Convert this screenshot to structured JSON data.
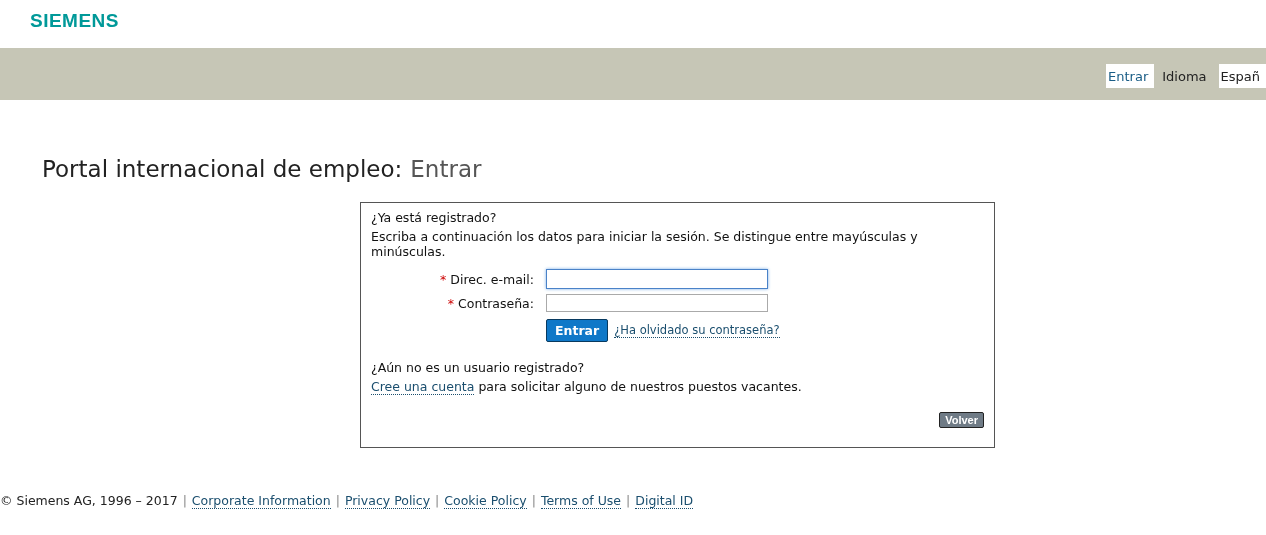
{
  "logo": "SIEMENS",
  "nav": [
    {
      "kind": "link",
      "label": "Entrar"
    },
    {
      "kind": "label",
      "label": "Idioma"
    },
    {
      "kind": "select",
      "label": "Españ"
    }
  ],
  "title": {
    "prefix": "Portal internacional de empleo:",
    "page": "Entrar"
  },
  "login": {
    "heading": "¿Ya está registrado?",
    "intro": "Escriba a continuación los datos para iniciar la sesión. Se distingue entre mayúsculas y minúsculas.",
    "fields": [
      {
        "required_mark": "*",
        "label": "Direc. e-mail:",
        "focused": true
      },
      {
        "required_mark": "*",
        "label": "Contraseña:",
        "focused": false
      }
    ],
    "submit": "Entrar",
    "forgot_link": "¿Ha olvidado su contraseña?"
  },
  "register": {
    "heading": "¿Aún no es un usuario registrado?",
    "link": "Cree una cuenta",
    "text": "para solicitar alguno de nuestros puestos vacantes."
  },
  "back_button": "Volver",
  "footer": {
    "copyright": "© Siemens AG, 1996 – 2017",
    "links": [
      {
        "separator": "|",
        "label": "Corporate Information"
      },
      {
        "separator": "|",
        "label": "Privacy Policy"
      },
      {
        "separator": "|",
        "label": "Cookie Policy"
      },
      {
        "separator": "|",
        "label": "Terms of Use"
      },
      {
        "separator": "|",
        "label": "Digital ID"
      }
    ]
  }
}
